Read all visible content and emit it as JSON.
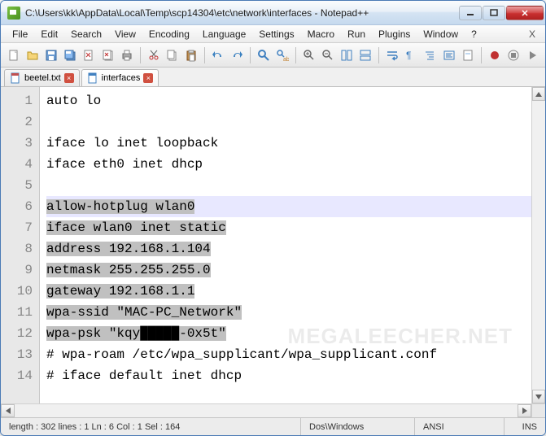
{
  "window": {
    "title": "C:\\Users\\kk\\AppData\\Local\\Temp\\scp14304\\etc\\network\\interfaces - Notepad++"
  },
  "menu": {
    "items": [
      "File",
      "Edit",
      "Search",
      "View",
      "Encoding",
      "Language",
      "Settings",
      "Macro",
      "Run",
      "Plugins",
      "Window",
      "?"
    ],
    "close": "X"
  },
  "tabs": [
    {
      "label": "beetel.txt",
      "active": false
    },
    {
      "label": "interfaces",
      "active": true
    }
  ],
  "editor": {
    "lines": [
      "auto lo",
      "",
      "iface lo inet loopback",
      "iface eth0 inet dhcp",
      "",
      "allow-hotplug wlan0",
      "iface wlan0 inet static",
      "address 192.168.1.104",
      "netmask 255.255.255.0",
      "gateway 192.168.1.1",
      "wpa-ssid \"MAC-PC_Network\"",
      "wpa-psk \"kqy█████-0x5t\"",
      "# wpa-roam /etc/wpa_supplicant/wpa_supplicant.conf",
      "# iface default inet dhcp"
    ],
    "current_line_index": 5,
    "selection_start": 5,
    "selection_end": 11
  },
  "status": {
    "left": "length : 302    lines : 1 Ln : 6    Col : 1    Sel : 164",
    "eol": "Dos\\Windows",
    "enc": "ANSI",
    "mode": "INS"
  },
  "watermark": "MEGALEECHER.NET"
}
